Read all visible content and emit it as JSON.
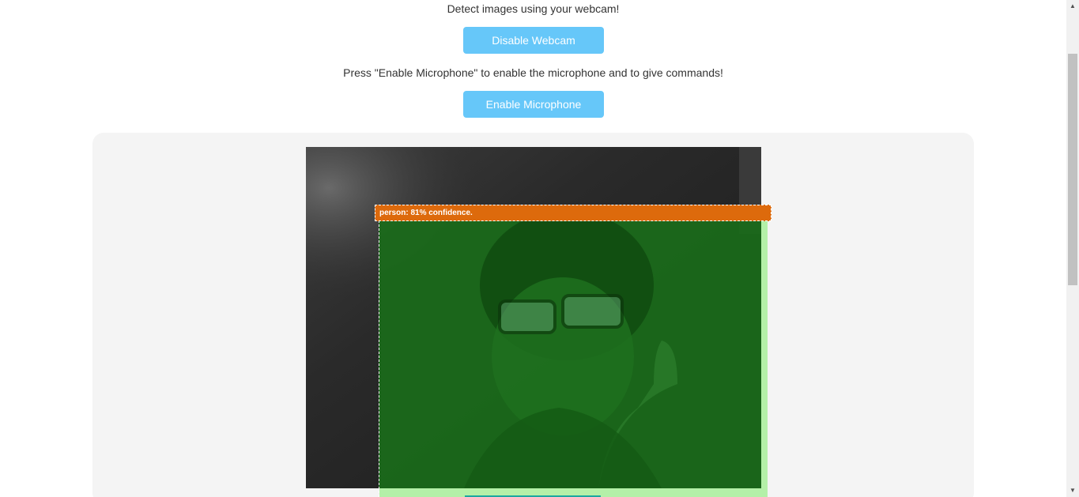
{
  "webcam_section": {
    "instruction": "Detect images using your webcam!",
    "toggle_button_label": "Disable Webcam"
  },
  "microphone_section": {
    "instruction": "Press \"Enable Microphone\" to enable the microphone and to give commands!",
    "toggle_button_label": "Enable Microphone"
  },
  "detection": {
    "label": "person: 81% confidence.",
    "class": "person",
    "confidence_percent": 81,
    "label_color": "#dd6a0c",
    "box_fill_color": "#1a7a1a"
  },
  "colors": {
    "button_bg": "#66c7f9",
    "panel_bg": "#f4f4f4"
  },
  "scrollbar": {
    "up_icon": "scroll-up-arrow",
    "down_icon": "scroll-down-arrow"
  }
}
